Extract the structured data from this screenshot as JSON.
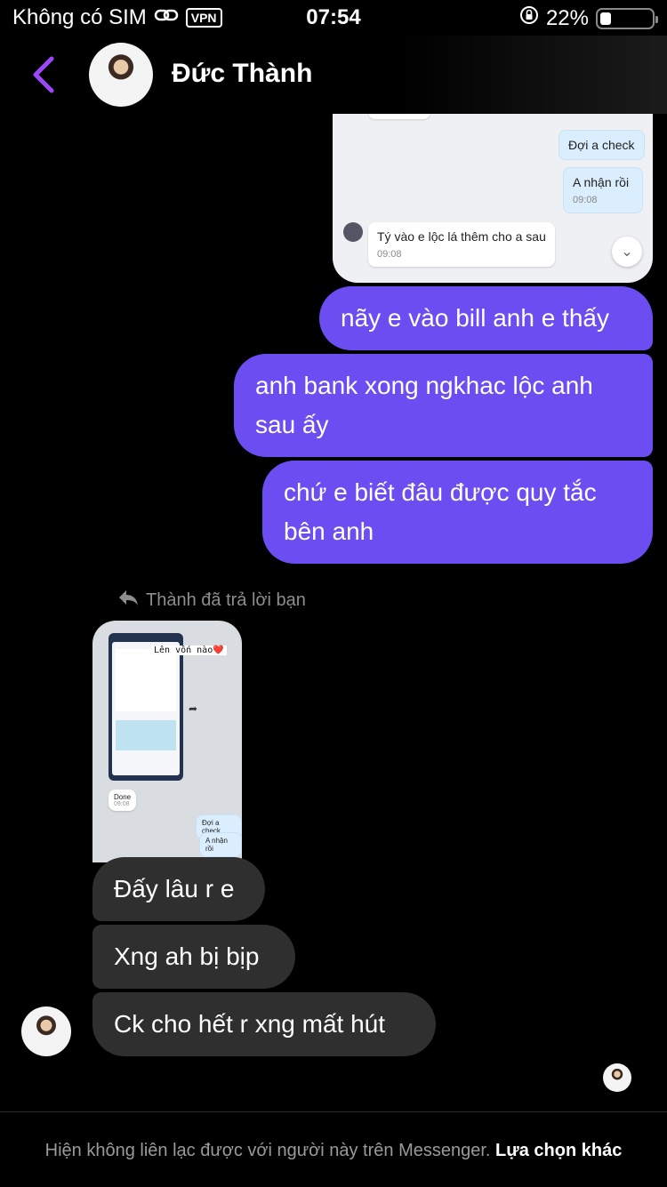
{
  "status_bar": {
    "carrier": "Không có SIM",
    "vpn": "VPN",
    "time": "07:54",
    "battery": "22%",
    "battery_level": 0.22
  },
  "header": {
    "name": "Đức Thành"
  },
  "shared_screenshot_top": {
    "msg1": "Đợi a check",
    "msg2": "A nhận rồi",
    "msg2_time": "09:08",
    "msg3": "Tý vào e lộc lá thêm cho a sau",
    "msg3_time": "09:08"
  },
  "messages_out": [
    "nãy e vào bill anh e thấy",
    "anh bank xong ngkhac lộc anh sau ấy",
    "chứ e biết đâu được quy tắc bên anh"
  ],
  "reply_note": "Thành đã trả lời bạn",
  "shared_screenshot_left": {
    "caption": "Lên vốn nào❤️",
    "done": "Done",
    "done_time": "09:08",
    "msg1": "Đợi a check",
    "msg2": "A nhận rồi"
  },
  "messages_in": [
    "Đấy lâu r e",
    "Xng ah bị bịp",
    "Ck cho hết r xng mất hút"
  ],
  "footer": {
    "text": "Hiện không liên lạc được với người này trên Messenger.",
    "link": "Lựa chọn khác"
  }
}
